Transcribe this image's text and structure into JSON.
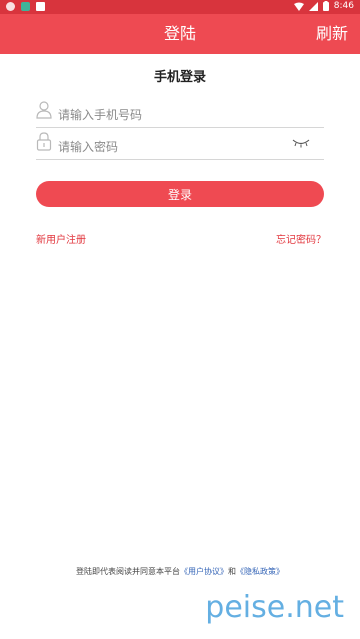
{
  "status_bar": {
    "time": "8:46"
  },
  "app_bar": {
    "title": "登陆",
    "refresh": "刷新"
  },
  "form": {
    "heading": "手机登录",
    "phone_placeholder": "请输入手机号码",
    "password_placeholder": "请输入密码",
    "login_button": "登录"
  },
  "links": {
    "register": "新用户注册",
    "forgot": "忘记密码？"
  },
  "agreement": {
    "prefix": "登陆即代表阅读并同意本平台",
    "user_agreement": "《用户协议》",
    "and": "和",
    "privacy_policy": "《隐私政策》"
  },
  "watermark": "peise.net",
  "colors": {
    "status_bar": "#d8343d",
    "app_bar": "#ee4a52",
    "accent": "#ef4a52",
    "link_blue": "#3565b7"
  }
}
